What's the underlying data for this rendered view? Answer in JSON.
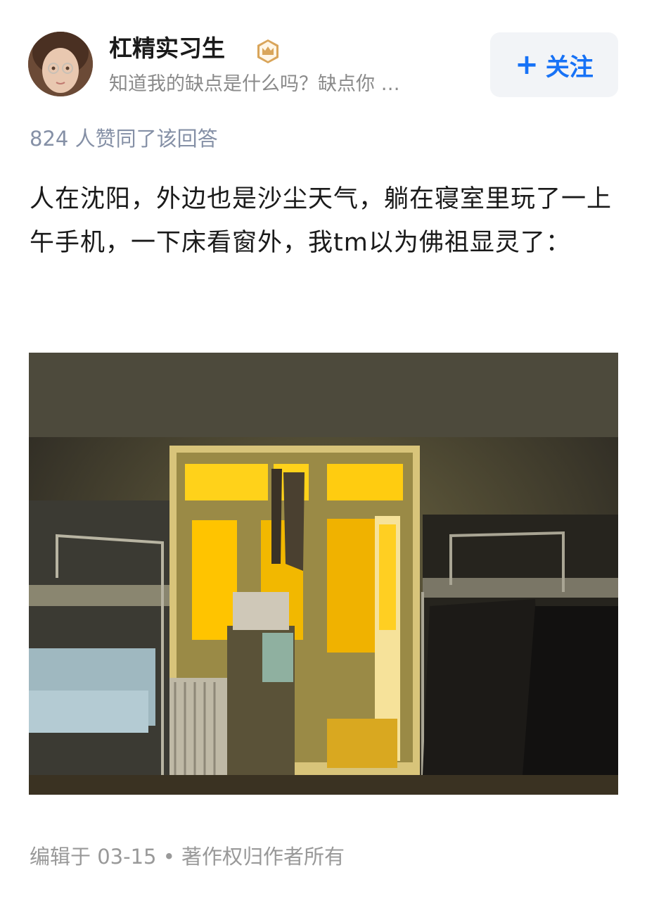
{
  "author": {
    "name": "杠精实习生",
    "bio": "知道我的缺点是什么吗？缺点你 …",
    "badge_icon": "crown-badge-icon",
    "badge_color": "#d9a55a"
  },
  "follow_button": {
    "icon": "plus-icon",
    "label": "关注",
    "color": "#1772f6"
  },
  "likes_text": "824 人赞同了该回答",
  "answer": {
    "text": "人在沈阳，外边也是沙尘天气，躺在寝室里玩了一上午手机，一下床看窗外，我tm以为佛祖显灵了："
  },
  "footer": {
    "edited": "编辑于 03-15",
    "separator": "•",
    "copyright": "著作权归作者所有"
  }
}
